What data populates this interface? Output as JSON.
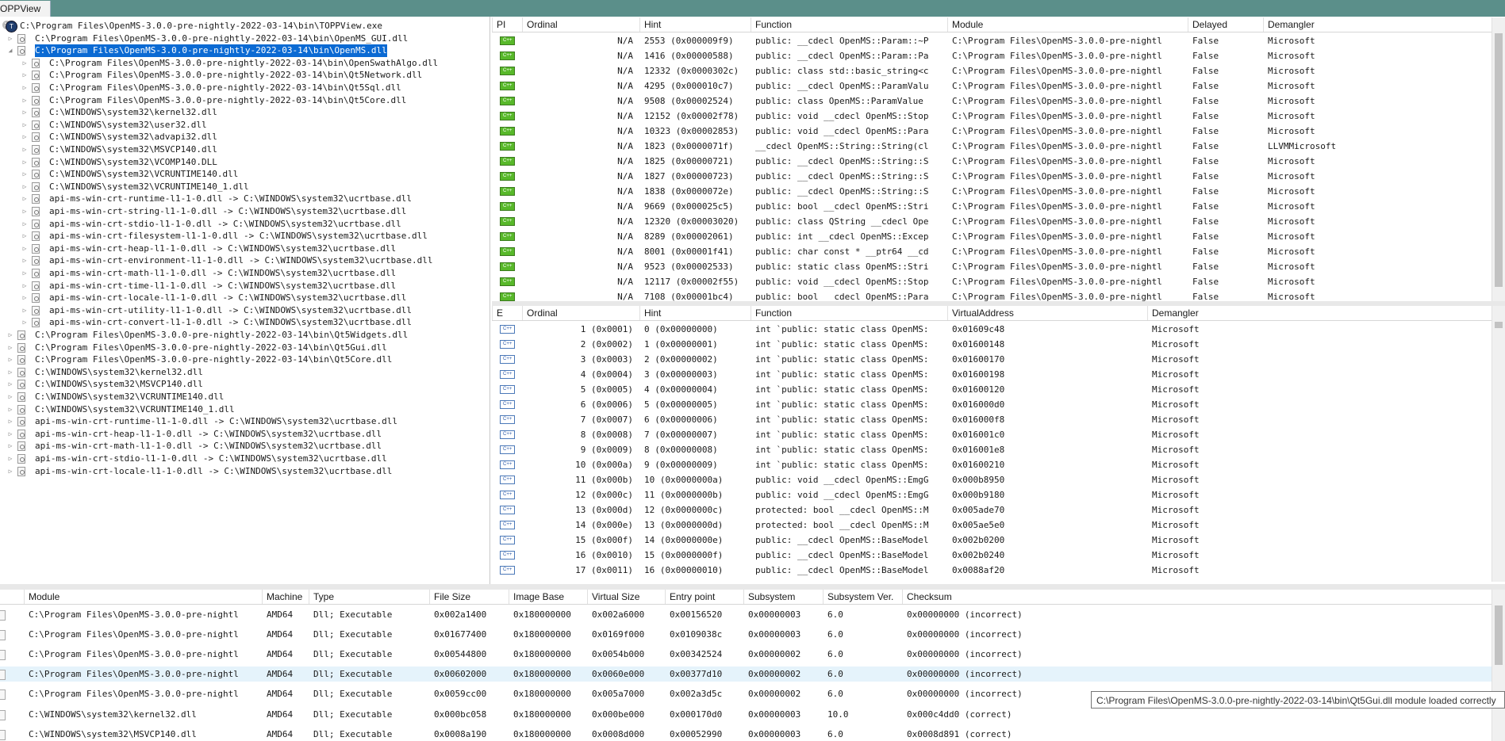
{
  "tab": {
    "title": "OPPView",
    "close": "✕"
  },
  "tree": {
    "root": {
      "label": "C:\\Program Files\\OpenMS-3.0.0-pre-nightly-2022-03-14\\bin\\TOPPView.exe",
      "icon": "app-icon"
    },
    "items": [
      {
        "label": "C:\\Program Files\\OpenMS-3.0.0-pre-nightly-2022-03-14\\bin\\OpenMS_GUI.dll",
        "level": 1,
        "expander": "▷"
      },
      {
        "label": "C:\\Program Files\\OpenMS-3.0.0-pre-nightly-2022-03-14\\bin\\OpenMS.dll",
        "level": 1,
        "expander": "◢",
        "selected": true
      },
      {
        "label": "C:\\Program Files\\OpenMS-3.0.0-pre-nightly-2022-03-14\\bin\\OpenSwathAlgo.dll",
        "level": 2,
        "expander": "▷"
      },
      {
        "label": "C:\\Program Files\\OpenMS-3.0.0-pre-nightly-2022-03-14\\bin\\Qt5Network.dll",
        "level": 2,
        "expander": "▷"
      },
      {
        "label": "C:\\Program Files\\OpenMS-3.0.0-pre-nightly-2022-03-14\\bin\\Qt5Sql.dll",
        "level": 2,
        "expander": "▷"
      },
      {
        "label": "C:\\Program Files\\OpenMS-3.0.0-pre-nightly-2022-03-14\\bin\\Qt5Core.dll",
        "level": 2,
        "expander": "▷"
      },
      {
        "label": "C:\\WINDOWS\\system32\\kernel32.dll",
        "level": 2,
        "expander": "▷"
      },
      {
        "label": "C:\\WINDOWS\\system32\\user32.dll",
        "level": 2,
        "expander": "▷"
      },
      {
        "label": "C:\\WINDOWS\\system32\\advapi32.dll",
        "level": 2,
        "expander": "▷"
      },
      {
        "label": "C:\\WINDOWS\\system32\\MSVCP140.dll",
        "level": 2,
        "expander": "▷"
      },
      {
        "label": "C:\\WINDOWS\\system32\\VCOMP140.DLL",
        "level": 2,
        "expander": "▷"
      },
      {
        "label": "C:\\WINDOWS\\system32\\VCRUNTIME140.dll",
        "level": 2,
        "expander": "▷"
      },
      {
        "label": "C:\\WINDOWS\\system32\\VCRUNTIME140_1.dll",
        "level": 2,
        "expander": "▷"
      },
      {
        "label": "api-ms-win-crt-runtime-l1-1-0.dll -> C:\\WINDOWS\\system32\\ucrtbase.dll",
        "level": 2,
        "expander": "▷"
      },
      {
        "label": "api-ms-win-crt-string-l1-1-0.dll -> C:\\WINDOWS\\system32\\ucrtbase.dll",
        "level": 2,
        "expander": "▷"
      },
      {
        "label": "api-ms-win-crt-stdio-l1-1-0.dll -> C:\\WINDOWS\\system32\\ucrtbase.dll",
        "level": 2,
        "expander": "▷"
      },
      {
        "label": "api-ms-win-crt-filesystem-l1-1-0.dll -> C:\\WINDOWS\\system32\\ucrtbase.dll",
        "level": 2,
        "expander": "▷"
      },
      {
        "label": "api-ms-win-crt-heap-l1-1-0.dll -> C:\\WINDOWS\\system32\\ucrtbase.dll",
        "level": 2,
        "expander": "▷"
      },
      {
        "label": "api-ms-win-crt-environment-l1-1-0.dll -> C:\\WINDOWS\\system32\\ucrtbase.dll",
        "level": 2,
        "expander": "▷"
      },
      {
        "label": "api-ms-win-crt-math-l1-1-0.dll -> C:\\WINDOWS\\system32\\ucrtbase.dll",
        "level": 2,
        "expander": "▷"
      },
      {
        "label": "api-ms-win-crt-time-l1-1-0.dll -> C:\\WINDOWS\\system32\\ucrtbase.dll",
        "level": 2,
        "expander": "▷"
      },
      {
        "label": "api-ms-win-crt-locale-l1-1-0.dll -> C:\\WINDOWS\\system32\\ucrtbase.dll",
        "level": 2,
        "expander": "▷"
      },
      {
        "label": "api-ms-win-crt-utility-l1-1-0.dll -> C:\\WINDOWS\\system32\\ucrtbase.dll",
        "level": 2,
        "expander": "▷"
      },
      {
        "label": "api-ms-win-crt-convert-l1-1-0.dll -> C:\\WINDOWS\\system32\\ucrtbase.dll",
        "level": 2,
        "expander": "▷"
      },
      {
        "label": "C:\\Program Files\\OpenMS-3.0.0-pre-nightly-2022-03-14\\bin\\Qt5Widgets.dll",
        "level": 1,
        "expander": "▷"
      },
      {
        "label": "C:\\Program Files\\OpenMS-3.0.0-pre-nightly-2022-03-14\\bin\\Qt5Gui.dll",
        "level": 1,
        "expander": "▷"
      },
      {
        "label": "C:\\Program Files\\OpenMS-3.0.0-pre-nightly-2022-03-14\\bin\\Qt5Core.dll",
        "level": 1,
        "expander": "▷"
      },
      {
        "label": "C:\\WINDOWS\\system32\\kernel32.dll",
        "level": 1,
        "expander": "▷"
      },
      {
        "label": "C:\\WINDOWS\\system32\\MSVCP140.dll",
        "level": 1,
        "expander": "▷"
      },
      {
        "label": "C:\\WINDOWS\\system32\\VCRUNTIME140.dll",
        "level": 1,
        "expander": "▷"
      },
      {
        "label": "C:\\WINDOWS\\system32\\VCRUNTIME140_1.dll",
        "level": 1,
        "expander": "▷"
      },
      {
        "label": "api-ms-win-crt-runtime-l1-1-0.dll -> C:\\WINDOWS\\system32\\ucrtbase.dll",
        "level": 1,
        "expander": "▷"
      },
      {
        "label": "api-ms-win-crt-heap-l1-1-0.dll -> C:\\WINDOWS\\system32\\ucrtbase.dll",
        "level": 1,
        "expander": "▷"
      },
      {
        "label": "api-ms-win-crt-math-l1-1-0.dll -> C:\\WINDOWS\\system32\\ucrtbase.dll",
        "level": 1,
        "expander": "▷"
      },
      {
        "label": "api-ms-win-crt-stdio-l1-1-0.dll -> C:\\WINDOWS\\system32\\ucrtbase.dll",
        "level": 1,
        "expander": "▷"
      },
      {
        "label": "api-ms-win-crt-locale-l1-1-0.dll -> C:\\WINDOWS\\system32\\ucrtbase.dll",
        "level": 1,
        "expander": "▷"
      }
    ]
  },
  "imports": {
    "columns": [
      "PI",
      "Ordinal",
      "Hint",
      "Function",
      "Module",
      "Delayed",
      "Demangler"
    ],
    "rows": [
      [
        "N/A",
        "2553 (0x000009f9)",
        "public: __cdecl OpenMS::Param::~P",
        "C:\\Program Files\\OpenMS-3.0.0-pre-nightl",
        "False",
        "Microsoft"
      ],
      [
        "N/A",
        "1416 (0x00000588)",
        "public: __cdecl OpenMS::Param::Pa",
        "C:\\Program Files\\OpenMS-3.0.0-pre-nightl",
        "False",
        "Microsoft"
      ],
      [
        "N/A",
        "12332 (0x0000302c)",
        "public: class std::basic_string<c",
        "C:\\Program Files\\OpenMS-3.0.0-pre-nightl",
        "False",
        "Microsoft"
      ],
      [
        "N/A",
        "4295 (0x000010c7)",
        "public: __cdecl OpenMS::ParamValu",
        "C:\\Program Files\\OpenMS-3.0.0-pre-nightl",
        "False",
        "Microsoft"
      ],
      [
        "N/A",
        "9508 (0x00002524)",
        "public: class OpenMS::ParamValue ",
        "C:\\Program Files\\OpenMS-3.0.0-pre-nightl",
        "False",
        "Microsoft"
      ],
      [
        "N/A",
        "12152 (0x00002f78)",
        "public: void __cdecl OpenMS::Stop",
        "C:\\Program Files\\OpenMS-3.0.0-pre-nightl",
        "False",
        "Microsoft"
      ],
      [
        "N/A",
        "10323 (0x00002853)",
        "public: void __cdecl OpenMS::Para",
        "C:\\Program Files\\OpenMS-3.0.0-pre-nightl",
        "False",
        "Microsoft"
      ],
      [
        "N/A",
        "1823 (0x0000071f)",
        "__cdecl OpenMS::String::String(cl",
        "C:\\Program Files\\OpenMS-3.0.0-pre-nightl",
        "False",
        "LLVMMicrosoft"
      ],
      [
        "N/A",
        "1825 (0x00000721)",
        "public: __cdecl OpenMS::String::S",
        "C:\\Program Files\\OpenMS-3.0.0-pre-nightl",
        "False",
        "Microsoft"
      ],
      [
        "N/A",
        "1827 (0x00000723)",
        "public: __cdecl OpenMS::String::S",
        "C:\\Program Files\\OpenMS-3.0.0-pre-nightl",
        "False",
        "Microsoft"
      ],
      [
        "N/A",
        "1838 (0x0000072e)",
        "public: __cdecl OpenMS::String::S",
        "C:\\Program Files\\OpenMS-3.0.0-pre-nightl",
        "False",
        "Microsoft"
      ],
      [
        "N/A",
        "9669 (0x000025c5)",
        "public: bool __cdecl OpenMS::Stri",
        "C:\\Program Files\\OpenMS-3.0.0-pre-nightl",
        "False",
        "Microsoft"
      ],
      [
        "N/A",
        "12320 (0x00003020)",
        "public: class QString __cdecl Ope",
        "C:\\Program Files\\OpenMS-3.0.0-pre-nightl",
        "False",
        "Microsoft"
      ],
      [
        "N/A",
        "8289 (0x00002061)",
        "public: int __cdecl OpenMS::Excep",
        "C:\\Program Files\\OpenMS-3.0.0-pre-nightl",
        "False",
        "Microsoft"
      ],
      [
        "N/A",
        "8001 (0x00001f41)",
        "public: char const * __ptr64 __cd",
        "C:\\Program Files\\OpenMS-3.0.0-pre-nightl",
        "False",
        "Microsoft"
      ],
      [
        "N/A",
        "9523 (0x00002533)",
        "public: static class OpenMS::Stri",
        "C:\\Program Files\\OpenMS-3.0.0-pre-nightl",
        "False",
        "Microsoft"
      ],
      [
        "N/A",
        "12117 (0x00002f55)",
        "public: void __cdecl OpenMS::Stop",
        "C:\\Program Files\\OpenMS-3.0.0-pre-nightl",
        "False",
        "Microsoft"
      ],
      [
        "N/A",
        "7108 (0x00001bc4)",
        "public: bool __cdecl OpenMS::Para",
        "C:\\Program Files\\OpenMS-3.0.0-pre-nightl",
        "False",
        "Microsoft"
      ]
    ]
  },
  "exports": {
    "columns": [
      "E",
      "Ordinal",
      "Hint",
      "Function",
      "VirtualAddress",
      "Demangler"
    ],
    "rows": [
      [
        "1 (0x0001)",
        "0 (0x00000000)",
        "int `public: static class OpenMS:",
        "0x01609c48",
        "Microsoft"
      ],
      [
        "2 (0x0002)",
        "1 (0x00000001)",
        "int `public: static class OpenMS:",
        "0x01600148",
        "Microsoft"
      ],
      [
        "3 (0x0003)",
        "2 (0x00000002)",
        "int `public: static class OpenMS:",
        "0x01600170",
        "Microsoft"
      ],
      [
        "4 (0x0004)",
        "3 (0x00000003)",
        "int `public: static class OpenMS:",
        "0x01600198",
        "Microsoft"
      ],
      [
        "5 (0x0005)",
        "4 (0x00000004)",
        "int `public: static class OpenMS:",
        "0x01600120",
        "Microsoft"
      ],
      [
        "6 (0x0006)",
        "5 (0x00000005)",
        "int `public: static class OpenMS:",
        "0x016000d0",
        "Microsoft"
      ],
      [
        "7 (0x0007)",
        "6 (0x00000006)",
        "int `public: static class OpenMS:",
        "0x016000f8",
        "Microsoft"
      ],
      [
        "8 (0x0008)",
        "7 (0x00000007)",
        "int `public: static class OpenMS:",
        "0x016001c0",
        "Microsoft"
      ],
      [
        "9 (0x0009)",
        "8 (0x00000008)",
        "int `public: static class OpenMS:",
        "0x016001e8",
        "Microsoft"
      ],
      [
        "10 (0x000a)",
        "9 (0x00000009)",
        "int `public: static class OpenMS:",
        "0x01600210",
        "Microsoft"
      ],
      [
        "11 (0x000b)",
        "10 (0x0000000a)",
        "public: void __cdecl OpenMS::EmgG",
        "0x000b8950",
        "Microsoft"
      ],
      [
        "12 (0x000c)",
        "11 (0x0000000b)",
        "public: void __cdecl OpenMS::EmgG",
        "0x000b9180",
        "Microsoft"
      ],
      [
        "13 (0x000d)",
        "12 (0x0000000c)",
        "protected: bool __cdecl OpenMS::M",
        "0x005ade70",
        "Microsoft"
      ],
      [
        "14 (0x000e)",
        "13 (0x0000000d)",
        "protected: bool __cdecl OpenMS::M",
        "0x005ae5e0",
        "Microsoft"
      ],
      [
        "15 (0x000f)",
        "14 (0x0000000e)",
        "public: __cdecl OpenMS::BaseModel",
        "0x002b0200",
        "Microsoft"
      ],
      [
        "16 (0x0010)",
        "15 (0x0000000f)",
        "public: __cdecl OpenMS::BaseModel",
        "0x002b0240",
        "Microsoft"
      ],
      [
        "17 (0x0011)",
        "16 (0x00000010)",
        "public: __cdecl OpenMS::BaseModel",
        "0x0088af20",
        "Microsoft"
      ]
    ]
  },
  "modules": {
    "columns": [
      "Module",
      "Machine",
      "Type",
      "File Size",
      "Image Base",
      "Virtual Size",
      "Entry point",
      "Subsystem",
      "Subsystem Ver.",
      "Checksum"
    ],
    "rows": [
      [
        "C:\\Program Files\\OpenMS-3.0.0-pre-nightl",
        "AMD64",
        "Dll; Executable",
        "0x002a1400",
        "0x180000000",
        "0x002a6000",
        "0x00156520",
        "0x00000003",
        "6.0",
        "0x00000000 (incorrect)"
      ],
      [
        "C:\\Program Files\\OpenMS-3.0.0-pre-nightl",
        "AMD64",
        "Dll; Executable",
        "0x01677400",
        "0x180000000",
        "0x0169f000",
        "0x0109038c",
        "0x00000003",
        "6.0",
        "0x00000000 (incorrect)"
      ],
      [
        "C:\\Program Files\\OpenMS-3.0.0-pre-nightl",
        "AMD64",
        "Dll; Executable",
        "0x00544800",
        "0x180000000",
        "0x0054b000",
        "0x00342524",
        "0x00000002",
        "6.0",
        "0x00000000 (incorrect)"
      ],
      [
        "C:\\Program Files\\OpenMS-3.0.0-pre-nightl",
        "AMD64",
        "Dll; Executable",
        "0x00602000",
        "0x180000000",
        "0x0060e000",
        "0x00377d10",
        "0x00000002",
        "6.0",
        "0x00000000 (incorrect)"
      ],
      [
        "C:\\Program Files\\OpenMS-3.0.0-pre-nightl",
        "AMD64",
        "Dll; Executable",
        "0x0059cc00",
        "0x180000000",
        "0x005a7000",
        "0x002a3d5c",
        "0x00000002",
        "6.0",
        "0x00000000 (incorrect)"
      ],
      [
        "C:\\WINDOWS\\system32\\kernel32.dll",
        "AMD64",
        "Dll; Executable",
        "0x000bc058",
        "0x180000000",
        "0x000be000",
        "0x000170d0",
        "0x00000003",
        "10.0",
        "0x000c4dd0 (correct)"
      ],
      [
        "C:\\WINDOWS\\system32\\MSVCP140.dll",
        "AMD64",
        "Dll; Executable",
        "0x0008a190",
        "0x180000000",
        "0x0008d000",
        "0x00052990",
        "0x00000003",
        "6.0",
        "0x0008d891 (correct)"
      ]
    ],
    "highlighted_row": 3
  },
  "tooltip": "C:\\Program Files\\OpenMS-3.0.0-pre-nightly-2022-03-14\\bin\\Qt5Gui.dll module loaded correctly",
  "colors": {
    "titlebar": "#5b8f8a",
    "selection": "#0b6ad3",
    "import_icon": "#58b82a",
    "export_icon": "#4a78b8",
    "row_highlight": "#e5f3fb"
  }
}
